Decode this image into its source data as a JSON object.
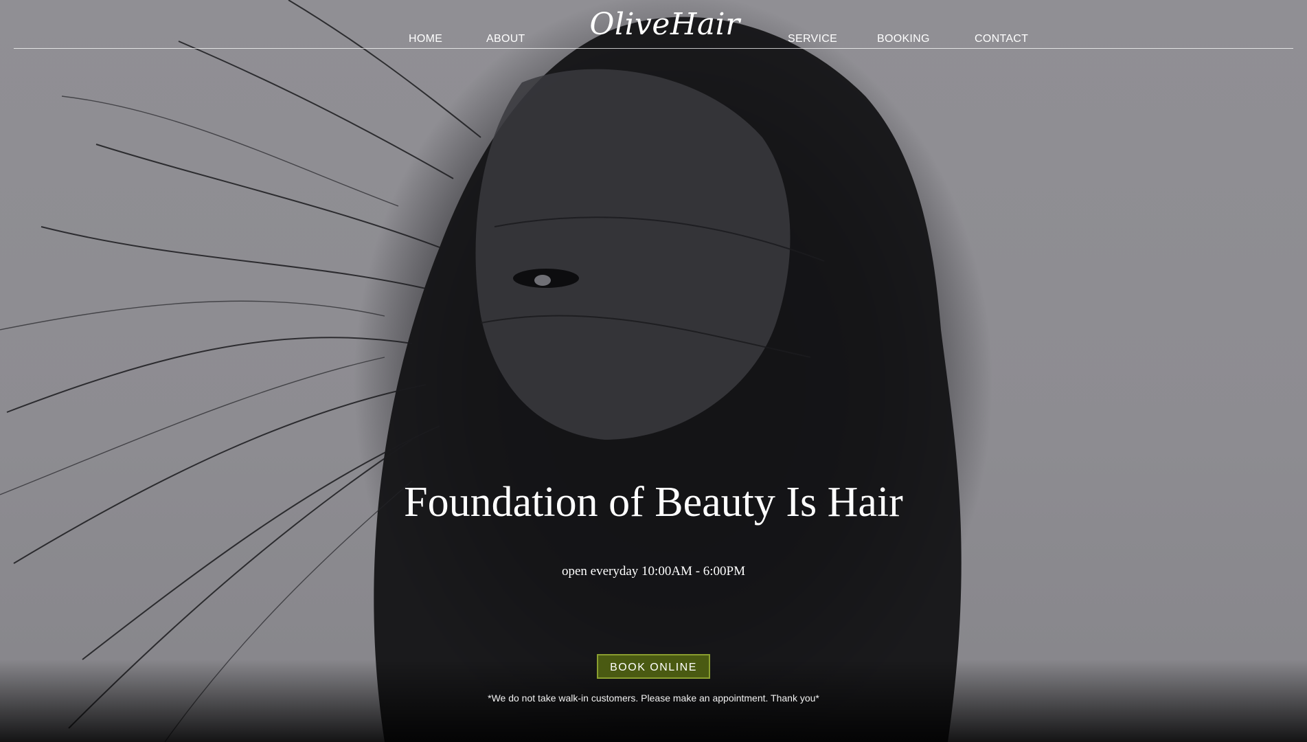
{
  "nav": {
    "home": "HOME",
    "about": "ABOUT",
    "service": "SERVICE",
    "booking": "BOOKING",
    "contact": "CONTACT"
  },
  "brand": {
    "logo": "OliveHair"
  },
  "hero": {
    "title": "Foundation of Beauty Is Hair",
    "hours": "open everyday 10:00AM - 6:00PM",
    "cta_label": "BOOK ONLINE",
    "notice": "*We do not take walk-in customers. Please make an appointment. Thank you*"
  },
  "colors": {
    "cta_background": "#4a5a12",
    "cta_border": "#8a9e2f",
    "background": "#8e8d91"
  }
}
